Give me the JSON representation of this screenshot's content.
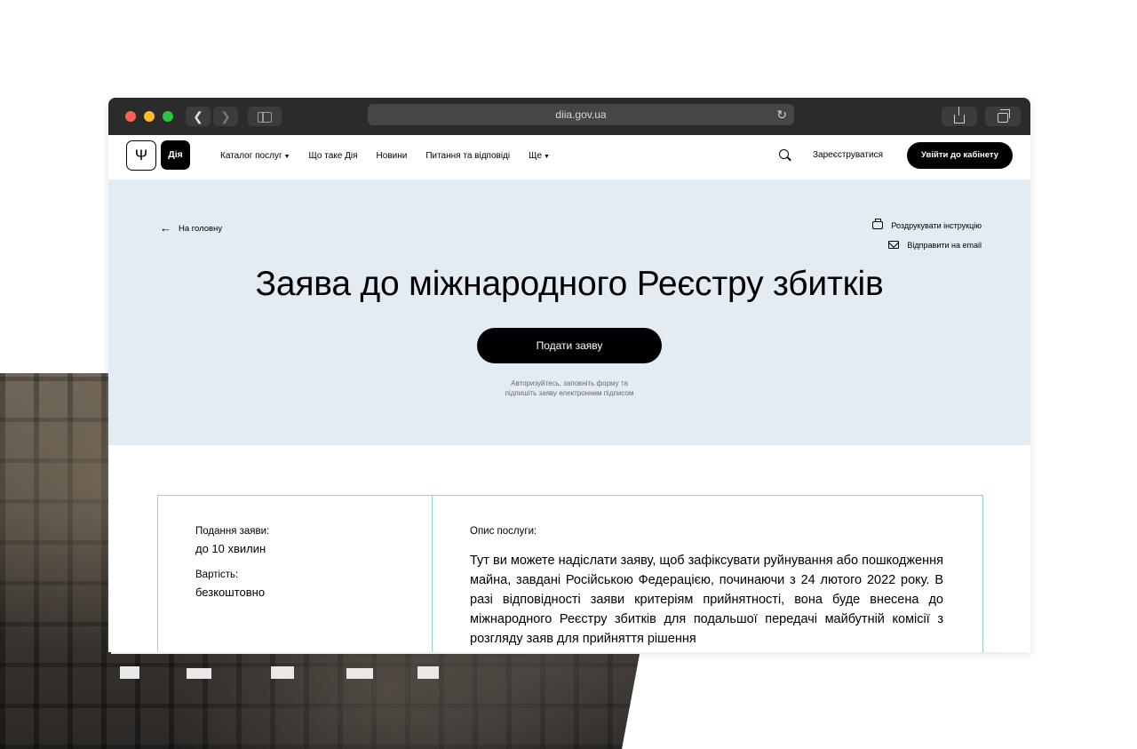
{
  "browser": {
    "url": "diia.gov.ua"
  },
  "header": {
    "logo_text": "Дія",
    "nav": [
      {
        "label": "Каталог послуг",
        "dropdown": true
      },
      {
        "label": "Що таке Дія",
        "dropdown": false
      },
      {
        "label": "Новини",
        "dropdown": false
      },
      {
        "label": "Питання та відповіді",
        "dropdown": false
      },
      {
        "label": "Ще",
        "dropdown": true
      }
    ],
    "register_label": "Зареєструватися",
    "login_label": "Увійти до кабінету"
  },
  "hero": {
    "back_label": "На головну",
    "print_label": "Роздрукувати інструкцію",
    "email_label": "Відправити на email",
    "title": "Заява до міжнародного Реєстру збитків",
    "apply_label": "Подати заяву",
    "hint_line1": "Авторизуйтесь, заповніть форму та",
    "hint_line2": "підпишіть заяву електронним підписом"
  },
  "info": {
    "duration_label": "Подання заяви:",
    "duration_value": "до 10 хвилин",
    "cost_label": "Вартість:",
    "cost_value": "безкоштовно",
    "description_label": "Опис послуги:",
    "description_text": "Тут ви можете надіслати заяву, щоб зафіксувати руйнування або пошкодження майна, завдані Російською Федерацією, починаючи з 24 лютого 2022 року. В разі відповідності заяви критеріям прийнятності, вона буде внесена до міжнародного Реєстру збитків для подальшої передачі майбутній комісії з розгляду заяв для прийняття рішення"
  },
  "colors": {
    "hero_bg": "#e3ebf3",
    "accent_border": "#8fd3d6",
    "button": "#000000"
  }
}
